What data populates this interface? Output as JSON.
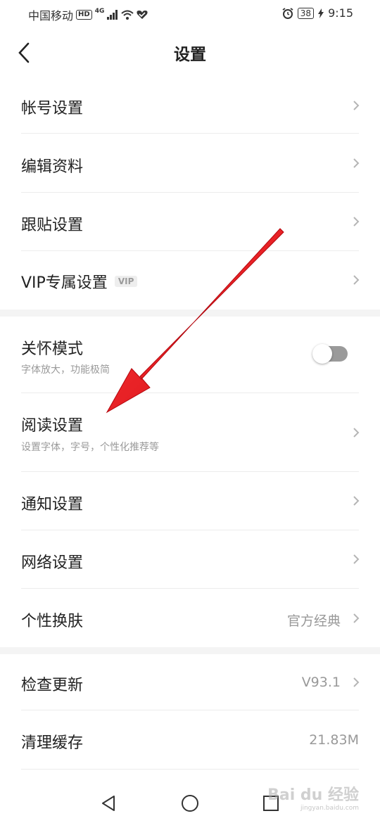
{
  "status_bar": {
    "carrier": "中国移动",
    "hd": "HD",
    "net": "4G",
    "battery": "38",
    "time": "9:15"
  },
  "header": {
    "title": "设置"
  },
  "settings": {
    "account": {
      "label": "帐号设置"
    },
    "edit_profile": {
      "label": "编辑资料"
    },
    "follow_post": {
      "label": "跟贴设置"
    },
    "vip": {
      "label": "VIP专属设置",
      "badge": "VIP"
    },
    "care_mode": {
      "label": "关怀模式",
      "subtitle": "字体放大，功能极简",
      "enabled": false
    },
    "reading": {
      "label": "阅读设置",
      "subtitle": "设置字体，字号，个性化推荐等"
    },
    "notification": {
      "label": "通知设置"
    },
    "network": {
      "label": "网络设置"
    },
    "skin": {
      "label": "个性换肤",
      "value": "官方经典"
    },
    "update": {
      "label": "检查更新",
      "value": "V93.1"
    },
    "cache": {
      "label": "清理缓存",
      "value": "21.83M"
    }
  },
  "watermark": {
    "text": "Bai du 经验",
    "sub": "jingyan.baidu.com"
  },
  "colors": {
    "arrow": "#e8121b",
    "toggle_off": "#9a9a9a",
    "divider": "#ececec",
    "section_gap": "#f4f4f4"
  }
}
